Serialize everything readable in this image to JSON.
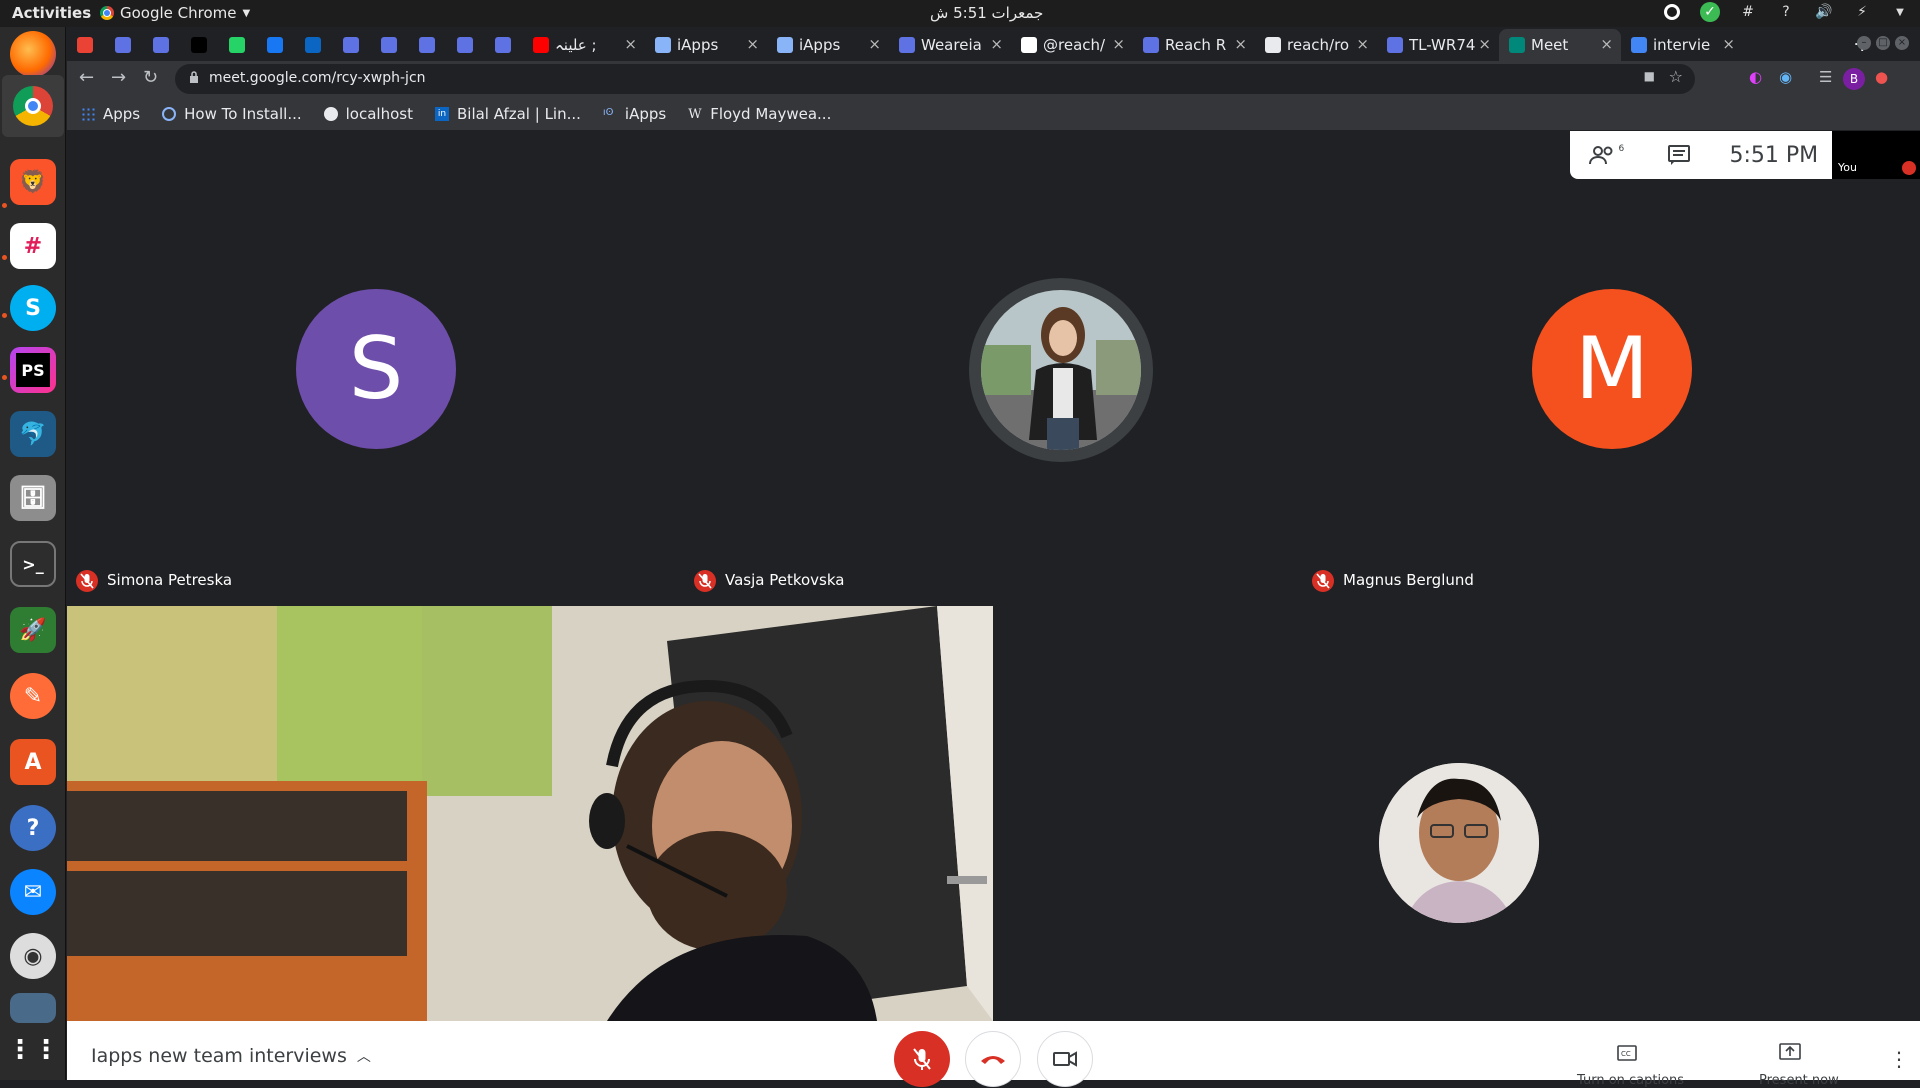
{
  "topbar": {
    "activities": "Activities",
    "app_name": "Google Chrome",
    "clock": "جمعرات 5:51 ش"
  },
  "tabs": [
    {
      "label": "",
      "icon": "gmail-icon"
    },
    {
      "label": "",
      "icon": "app-icon"
    },
    {
      "label": "",
      "icon": "app-icon"
    },
    {
      "label": "",
      "icon": "dev-icon"
    },
    {
      "label": "",
      "icon": "whatsapp-icon"
    },
    {
      "label": "",
      "icon": "facebook-icon"
    },
    {
      "label": "",
      "icon": "linkedin-icon"
    },
    {
      "label": "",
      "icon": "app-icon"
    },
    {
      "label": "",
      "icon": "app-icon"
    },
    {
      "label": "",
      "icon": "app-icon"
    },
    {
      "label": "",
      "icon": "app-icon"
    },
    {
      "label": "",
      "icon": "app-icon"
    },
    {
      "label": "علینہ ;",
      "icon": "youtube-icon"
    },
    {
      "label": "iApps",
      "icon": "iapps-icon"
    },
    {
      "label": "iApps",
      "icon": "iapps-icon"
    },
    {
      "label": "Weareia",
      "icon": "app-icon"
    },
    {
      "label": "@reach/",
      "icon": "google-icon"
    },
    {
      "label": "Reach R",
      "icon": "app-icon"
    },
    {
      "label": "reach/ro",
      "icon": "github-icon"
    },
    {
      "label": "TL-WR74",
      "icon": "app-icon"
    },
    {
      "label": "Meet",
      "icon": "meet-icon",
      "active": true
    },
    {
      "label": "intervie",
      "icon": "docs-icon"
    }
  ],
  "new_tab": "+",
  "address_bar": {
    "url": "meet.google.com/rcy-xwph-jcn"
  },
  "profile_initial": "B",
  "bookmarks": [
    {
      "label": "Apps",
      "icon": "apps-grid-icon"
    },
    {
      "label": "How To Install...",
      "icon": "bookmark-icon"
    },
    {
      "label": "localhost",
      "icon": "globe-icon"
    },
    {
      "label": "Bilal Afzal | Lin...",
      "icon": "linkedin-icon"
    },
    {
      "label": "iApps",
      "icon": "iapps-icon"
    },
    {
      "label": "Floyd Maywea...",
      "icon": "wikipedia-icon"
    }
  ],
  "meet": {
    "people_count": "6",
    "time": "5:51 PM",
    "self_label": "You",
    "participants": [
      {
        "name": "Simona Petreska",
        "initial": "S",
        "color": "#6e4eab"
      },
      {
        "name": "Vasja Petkovska",
        "initial": "",
        "color": "#5f6368"
      },
      {
        "name": "Magnus Berglund",
        "initial": "M",
        "color": "#f4511e"
      }
    ],
    "meeting_title": "Iapps new team interviews",
    "captions_label": "Turn on captions",
    "present_label": "Present now"
  },
  "colors": {
    "mic_off_red": "#d93025",
    "chrome_dark": "#202124",
    "toolbar": "#35363a"
  }
}
